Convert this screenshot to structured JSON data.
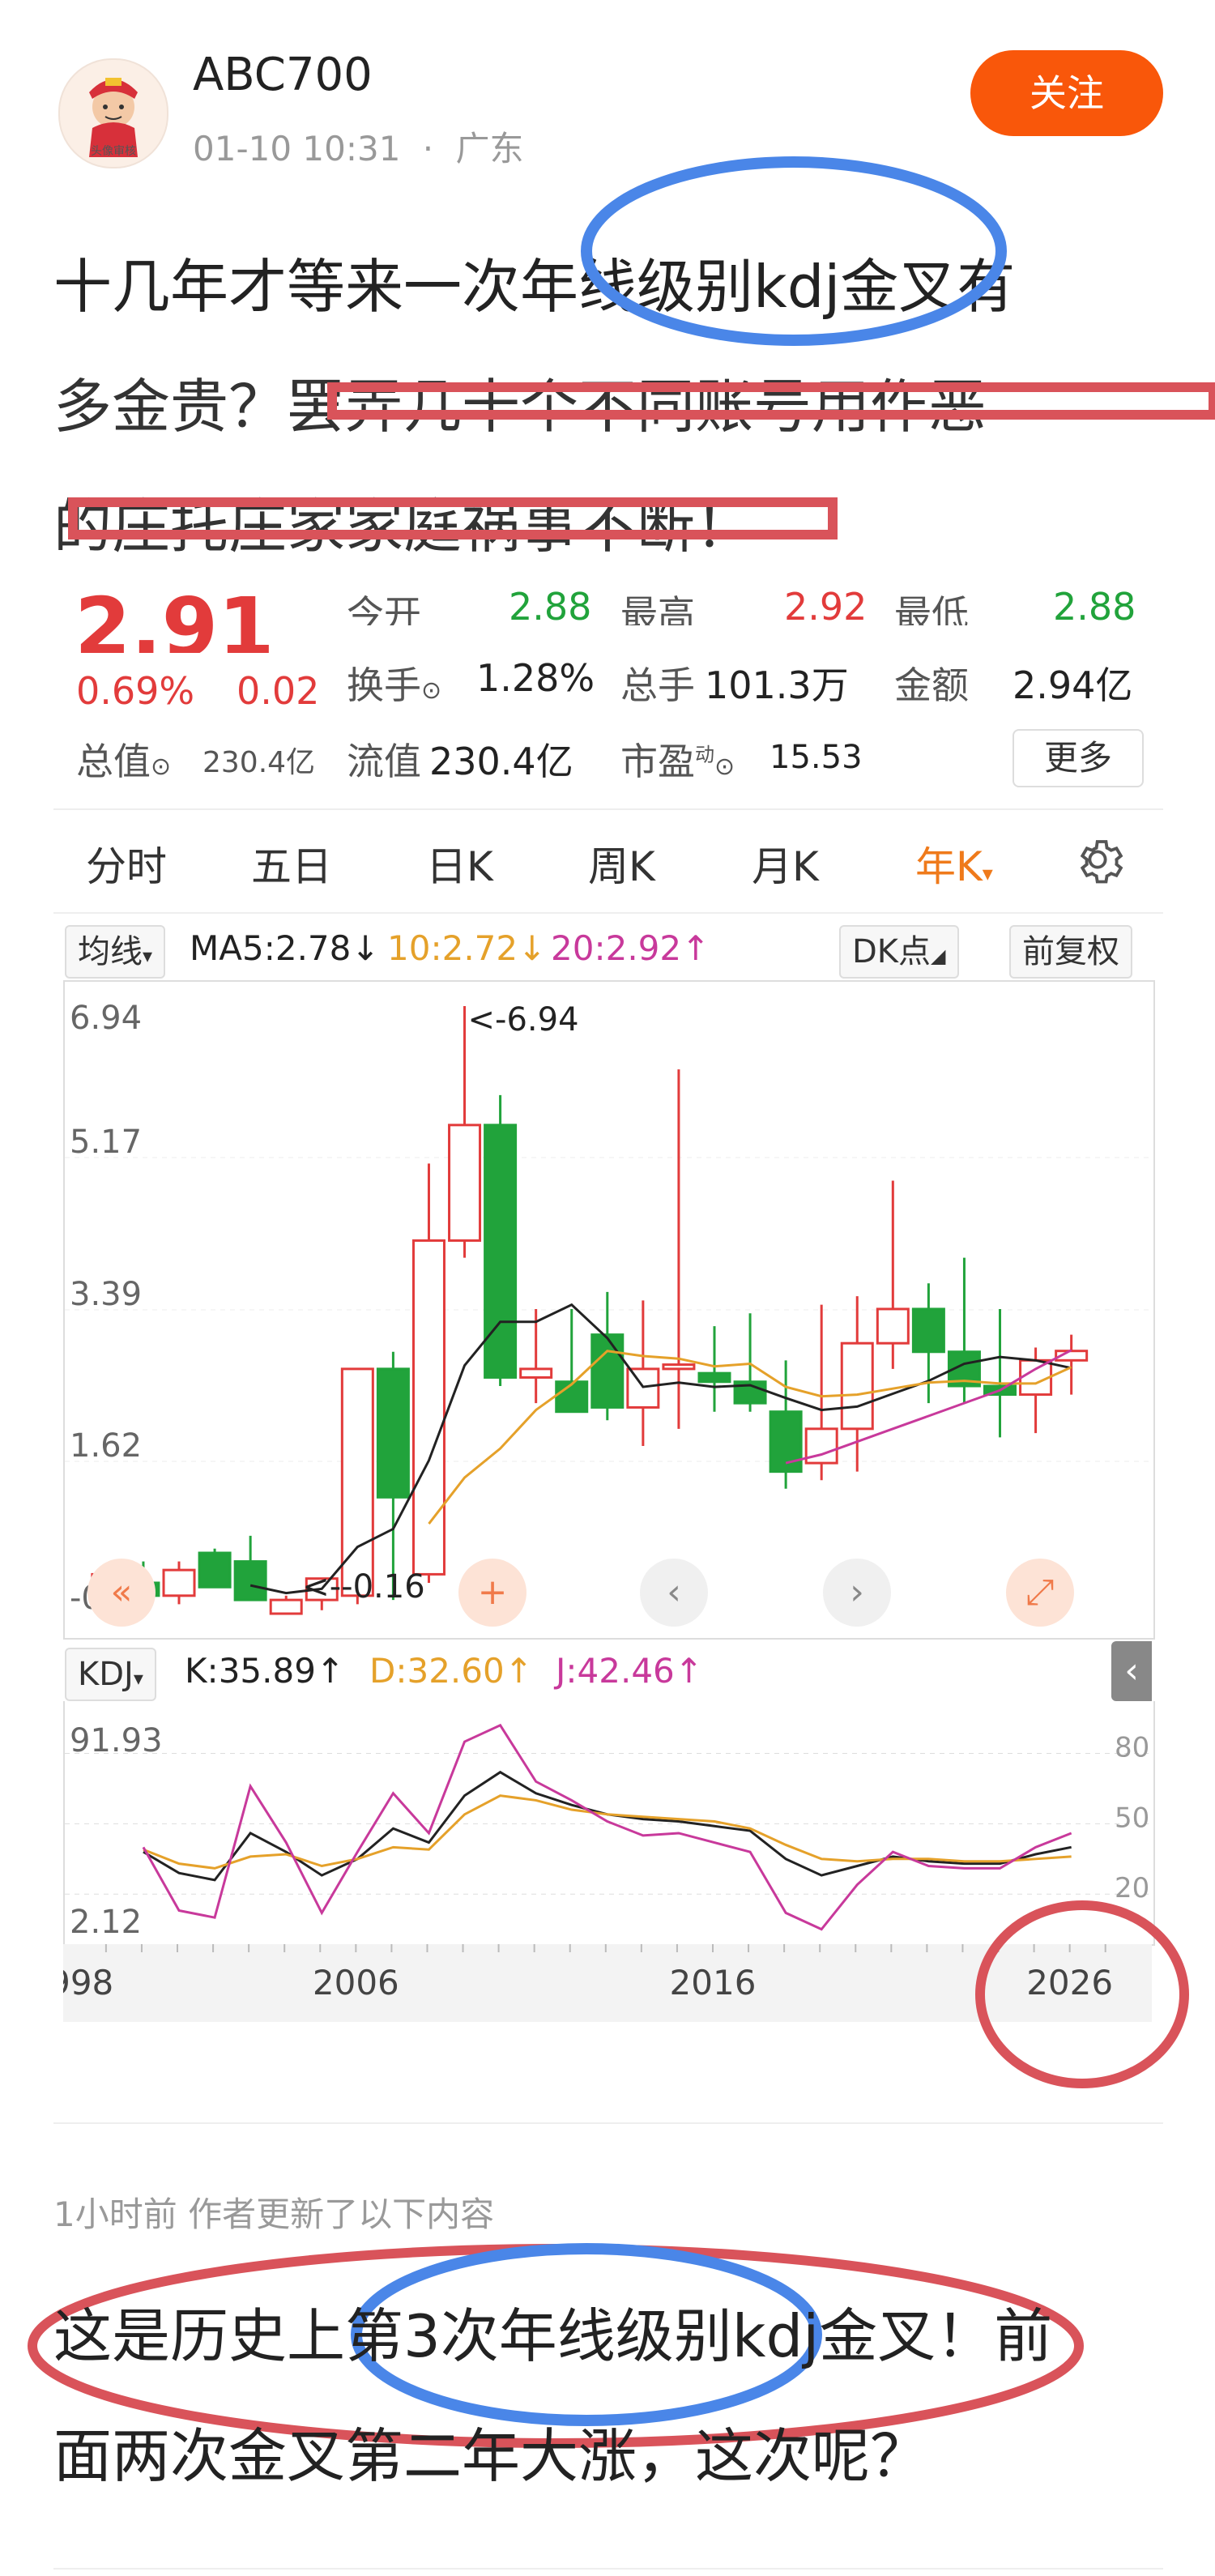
{
  "author": {
    "name": "ABC700",
    "avatar_label": "头像审核",
    "time": "01-10 10:31",
    "location": "广东",
    "follow_label": "关注"
  },
  "post": {
    "title_lines": [
      "十几年才等来一次年线级别kdj金叉有",
      "多金贵？罢弄几十个不同账号用作恶",
      "的庄托庄家家庭祸事不断！"
    ]
  },
  "quote": {
    "price": "2.91",
    "change_pct": "0.69%",
    "change_val": "0.02",
    "open_label": "今开",
    "open_val": "2.88",
    "high_label": "最高",
    "high_val": "2.92",
    "low_label": "最低",
    "low_val": "2.88",
    "turnover_label": "换手",
    "turnover_val": "1.28%",
    "volume_label": "总手",
    "volume_val": "101.3万",
    "amount_label": "金额",
    "amount_val": "2.94亿",
    "mktcap_label": "总值",
    "mktcap_val": "230.4亿",
    "float_label": "流值",
    "float_val": "230.4亿",
    "pe_label": "市盈",
    "pe_sup": "动",
    "pe_val": "15.53",
    "more_label": "更多"
  },
  "tabs": [
    "分时",
    "五日",
    "日K",
    "周K",
    "月K",
    "年K"
  ],
  "toolbar": {
    "ma_select": "均线",
    "ma5": "MA5:2.78",
    "ma10": "10:2.72",
    "ma20": "20:2.92",
    "dk_select": "DK点",
    "adjust_select": "前复权",
    "kdj_select": "KDJ",
    "k_val": "K:35.89",
    "d_val": "D:32.60",
    "j_val": "J:42.46"
  },
  "colors": {
    "up": "#e23b3b",
    "down": "#21a33b",
    "ma5": "#222222",
    "ma10": "#e5a12a",
    "ma20": "#c8399b",
    "accent": "#f9570a",
    "annot_blue": "#4a86e8",
    "annot_red": "#d9535a"
  },
  "update": {
    "note": "1小时前 作者更新了以下内容",
    "text_lines": [
      "这是历史上第3次年线级别kdj金叉！前",
      "面两次金叉第二年大涨，这次呢？"
    ]
  },
  "chart_data": [
    {
      "type": "candlestick",
      "title": "",
      "yticks": [
        "6.94",
        "5.17",
        "3.39",
        "1.62",
        "-0.16"
      ],
      "ylim": [
        -0.16,
        6.94
      ],
      "annotations": [
        "<-6.94",
        "<--0.16"
      ],
      "x": [
        1999,
        2000,
        2001,
        2002,
        2003,
        2004,
        2005,
        2006,
        2007,
        2008,
        2009,
        2010,
        2011,
        2012,
        2013,
        2014,
        2015,
        2016,
        2017,
        2018,
        2019,
        2020,
        2021,
        2022,
        2023,
        2024,
        2025,
        2026
      ],
      "open": [
        0.15,
        0.2,
        0.05,
        0.55,
        0.45,
        -0.16,
        0.0,
        0.05,
        2.7,
        0.3,
        4.2,
        5.55,
        2.6,
        2.55,
        3.1,
        2.25,
        2.7,
        2.65,
        2.55,
        2.2,
        1.6,
        2.0,
        3.0,
        3.4,
        2.9,
        2.5,
        2.4,
        2.8
      ],
      "high": [
        0.35,
        0.45,
        0.45,
        0.6,
        0.75,
        0.05,
        0.15,
        1.3,
        2.9,
        5.1,
        6.94,
        5.9,
        3.4,
        3.4,
        3.6,
        3.5,
        6.2,
        3.2,
        3.35,
        2.8,
        3.45,
        3.55,
        4.9,
        3.7,
        4.0,
        3.4,
        2.95,
        3.1
      ],
      "low": [
        0.0,
        -0.05,
        -0.05,
        0.15,
        0.05,
        -0.16,
        -0.12,
        -0.05,
        0.0,
        0.2,
        4.0,
        2.5,
        2.3,
        2.2,
        2.1,
        1.8,
        2.0,
        2.2,
        2.2,
        1.3,
        1.4,
        1.5,
        2.7,
        2.3,
        2.3,
        1.9,
        1.95,
        2.4
      ],
      "close": [
        0.3,
        0.05,
        0.35,
        0.15,
        0.0,
        0.0,
        0.25,
        2.7,
        1.2,
        4.2,
        5.55,
        2.6,
        2.7,
        2.2,
        2.25,
        2.7,
        2.75,
        2.55,
        2.3,
        1.5,
        2.0,
        3.0,
        3.4,
        2.9,
        2.5,
        2.4,
        2.8,
        2.91
      ],
      "ma5": [
        null,
        null,
        null,
        null,
        0.17,
        0.08,
        0.13,
        0.62,
        0.83,
        1.63,
        2.74,
        3.25,
        3.25,
        3.45,
        3.06,
        2.49,
        2.54,
        2.49,
        2.51,
        2.36,
        2.22,
        2.26,
        2.41,
        2.56,
        2.76,
        2.84,
        2.8,
        2.71
      ],
      "ma10": [
        null,
        null,
        null,
        null,
        null,
        null,
        null,
        null,
        null,
        0.89,
        1.43,
        1.77,
        2.22,
        2.52,
        2.91,
        2.85,
        2.82,
        2.73,
        2.76,
        2.49,
        2.38,
        2.4,
        2.47,
        2.54,
        2.56,
        2.53,
        2.53,
        2.72
      ],
      "ma20": [
        null,
        null,
        null,
        null,
        null,
        null,
        null,
        null,
        null,
        null,
        null,
        null,
        null,
        null,
        null,
        null,
        null,
        null,
        null,
        1.6,
        1.7,
        1.85,
        2.0,
        2.15,
        2.3,
        2.45,
        2.7,
        2.92
      ]
    },
    {
      "type": "line",
      "title": "KDJ",
      "yticks_left": [
        "91.93",
        "2.12"
      ],
      "yticks_right": [
        "80",
        "50",
        "20"
      ],
      "ylim": [
        2.12,
        91.93
      ],
      "xticks": [
        "1998",
        "2006",
        "2016",
        "2026"
      ],
      "x": [
        2000,
        2001,
        2002,
        2003,
        2004,
        2005,
        2006,
        2007,
        2008,
        2009,
        2010,
        2011,
        2012,
        2013,
        2014,
        2015,
        2016,
        2017,
        2018,
        2019,
        2020,
        2021,
        2022,
        2023,
        2024,
        2025,
        2026
      ],
      "series": [
        {
          "name": "K",
          "values": [
            38,
            29,
            26,
            46,
            38,
            28,
            35,
            48,
            42,
            62,
            72,
            63,
            58,
            54,
            52,
            51,
            49,
            47,
            35,
            28,
            32,
            36,
            34,
            33,
            33,
            37,
            40
          ]
        },
        {
          "name": "D",
          "values": [
            39,
            33,
            31,
            36,
            37,
            32,
            35,
            40,
            39,
            54,
            62,
            60,
            56,
            54,
            53,
            52,
            51,
            48,
            41,
            35,
            34,
            35,
            35,
            34,
            34,
            35,
            36
          ]
        },
        {
          "name": "J",
          "values": [
            40,
            13,
            10,
            66,
            42,
            12,
            38,
            63,
            46,
            85,
            92,
            68,
            60,
            51,
            45,
            46,
            42,
            38,
            12,
            5,
            24,
            38,
            32,
            31,
            31,
            40,
            46
          ]
        }
      ]
    }
  ]
}
